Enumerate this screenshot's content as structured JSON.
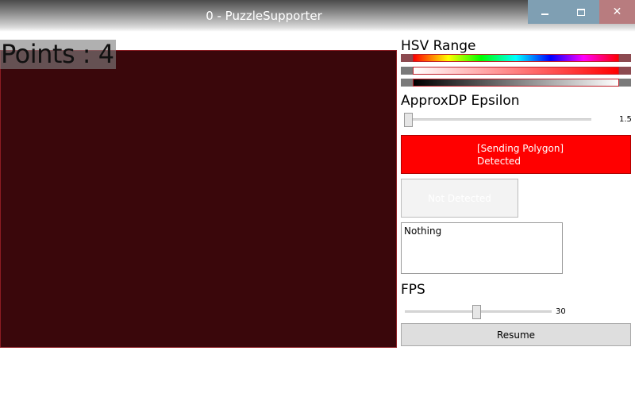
{
  "window": {
    "title": "0 - PuzzleSupporter",
    "controls": [
      "minimize-icon",
      "maximize-icon",
      "close-icon"
    ],
    "close_glyph": "✕"
  },
  "preview": {
    "points_label": "Points : 4",
    "background_color": "#3a070b"
  },
  "hsv": {
    "label": "HSV Range"
  },
  "epsilon": {
    "label": "ApproxDP Epsilon",
    "value": "1.5"
  },
  "status": {
    "detected_line1": "[Sending Polygon]",
    "detected_line2": "Detected",
    "detected_color": "#ff0000",
    "not_detected": "Not Detected"
  },
  "log": {
    "text": "Nothing"
  },
  "fps": {
    "label": "FPS",
    "value": "30"
  },
  "actions": {
    "resume_label": "Resume"
  }
}
